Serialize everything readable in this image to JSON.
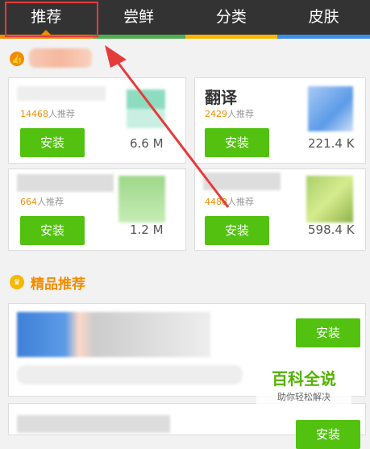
{
  "tabs": [
    {
      "label": "推荐",
      "bar_color": "#f28c00"
    },
    {
      "label": "尝鲜",
      "bar_color": "#4caf50"
    },
    {
      "label": "分类",
      "bar_color": "#f5b800"
    },
    {
      "label": "皮肤",
      "bar_color": "#3a8ee6"
    }
  ],
  "apps": [
    {
      "name": "",
      "count": "14468",
      "count_suffix": "人推荐",
      "install_label": "安装",
      "size": "6.6 M"
    },
    {
      "name": "翻译",
      "count": "2429",
      "count_suffix": "人推荐",
      "install_label": "安装",
      "size": "221.4 K"
    },
    {
      "name": "",
      "count": "664",
      "count_suffix": "人推荐",
      "install_label": "安装",
      "size": "1.2 M"
    },
    {
      "name": "",
      "count": "4488",
      "count_suffix": "人推荐",
      "install_label": "安装",
      "size": "598.4 K"
    }
  ],
  "featured": {
    "title": "精品推荐",
    "items": [
      {
        "install_label": "安装"
      },
      {
        "install_label": "安装"
      }
    ]
  },
  "watermark": {
    "title": "百科全说",
    "subtitle": "助你轻松解决"
  },
  "colors": {
    "accent": "#f28c00",
    "install": "#52c10f",
    "annotation": "#e63b3b"
  }
}
